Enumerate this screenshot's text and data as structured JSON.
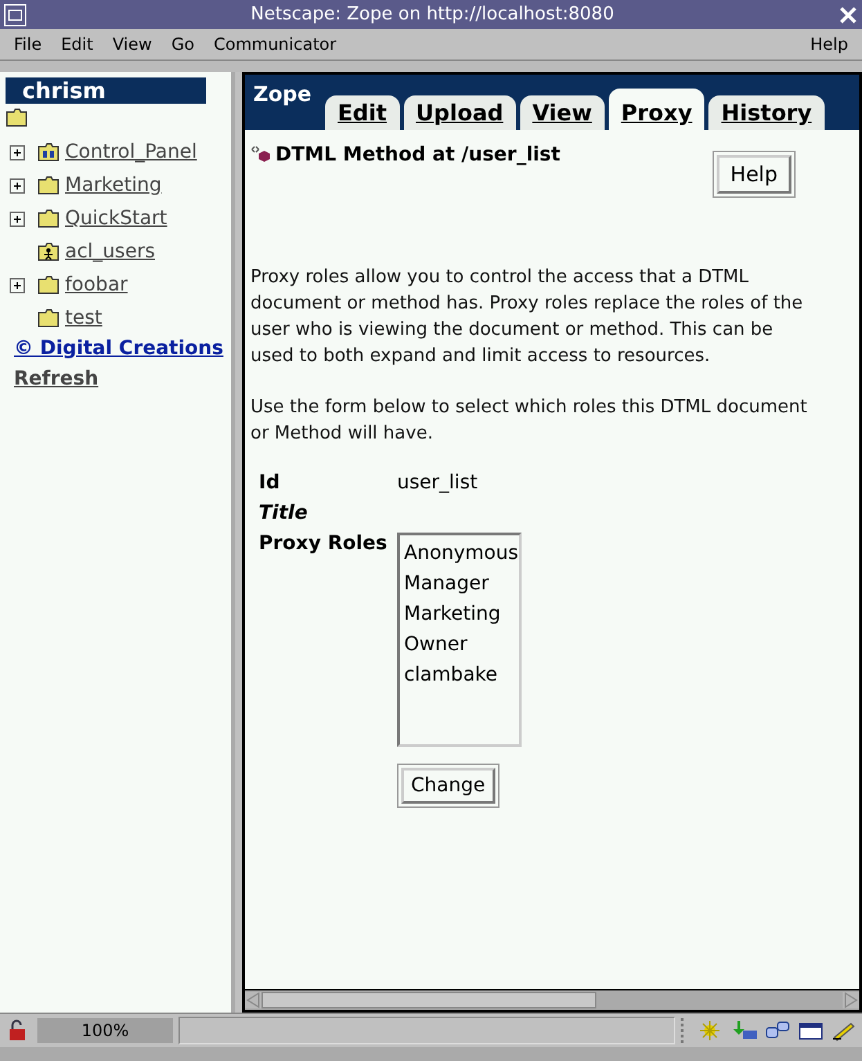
{
  "window": {
    "title": "Netscape: Zope on http://localhost:8080"
  },
  "menu": [
    "File",
    "Edit",
    "View",
    "Go",
    "Communicator"
  ],
  "help_menu": "Help",
  "sidebar": {
    "user": "chrism",
    "items": [
      {
        "label": "Control_Panel ",
        "kind": "control",
        "expandable": true
      },
      {
        "label": "Marketing ",
        "kind": "folder",
        "expandable": true
      },
      {
        "label": "QuickStart ",
        "kind": "folder",
        "expandable": true
      },
      {
        "label": "acl_users ",
        "kind": "users",
        "expandable": false
      },
      {
        "label": "foobar ",
        "kind": "folder",
        "expandable": true
      },
      {
        "label": "test ",
        "kind": "folder",
        "expandable": false
      }
    ],
    "copyright": "© Digital Creations ",
    "refresh": "Refresh"
  },
  "logo": "Zope",
  "tabs": [
    {
      "label": "Edit",
      "selected": false
    },
    {
      "label": "Upload",
      "selected": false
    },
    {
      "label": "View",
      "selected": false
    },
    {
      "label": "Proxy",
      "selected": true
    },
    {
      "label": "History",
      "selected": false
    }
  ],
  "heading": "DTML Method at /user_list",
  "help_button": "Help",
  "paragraphs": [
    "Proxy roles allow you to control the access that a DTML document or method has. Proxy roles replace the roles of the user who is viewing the document or method. This can be used to both expand and limit access to resources.",
    "Use the form below to select which roles this DTML document or Method will have."
  ],
  "form": {
    "id_label": "Id",
    "id_value": "user_list",
    "title_label": "Title",
    "roles_label": "Proxy Roles",
    "roles": [
      "Anonymous",
      "Manager",
      "Marketing",
      "Owner",
      "clambake"
    ],
    "button": "Change"
  },
  "status_bar": {
    "zoom": "100%"
  }
}
